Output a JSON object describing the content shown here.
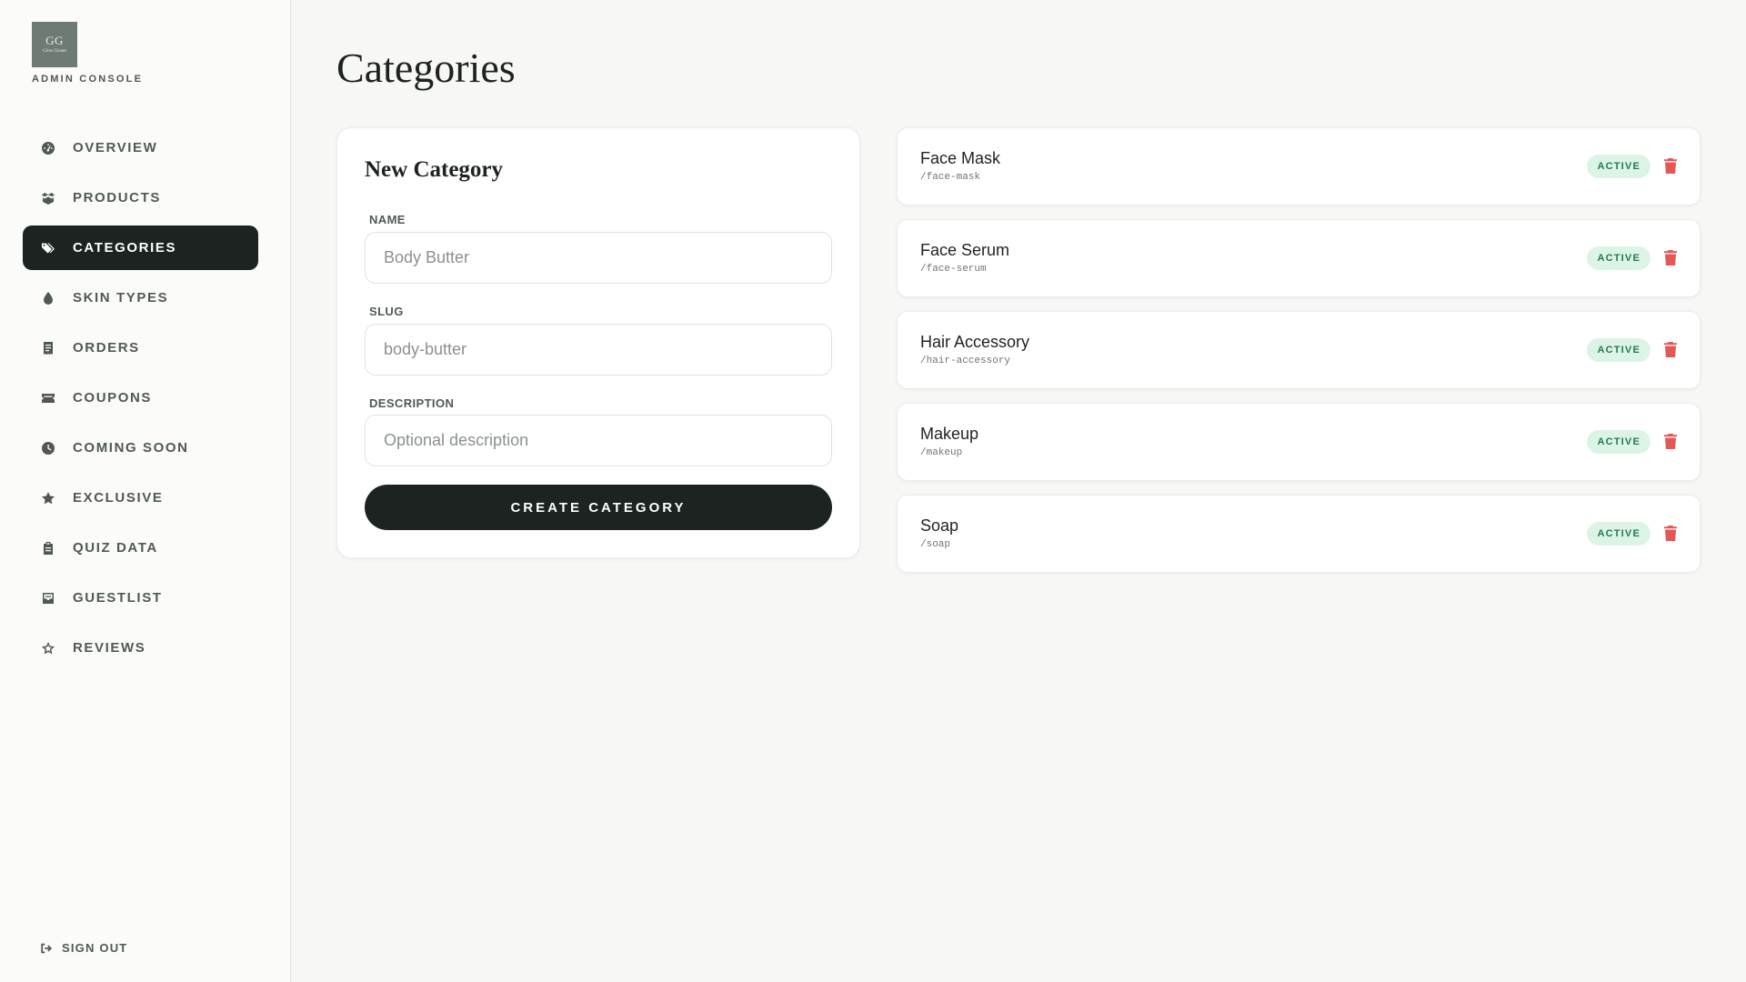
{
  "brand": {
    "logo_mark": "GG",
    "logo_small": "Glow Gleam",
    "subtitle": "ADMIN CONSOLE"
  },
  "sidebar": {
    "items": [
      {
        "label": "OVERVIEW",
        "icon": "dashboard-icon"
      },
      {
        "label": "PRODUCTS",
        "icon": "box-icon"
      },
      {
        "label": "CATEGORIES",
        "icon": "tags-icon",
        "active": true
      },
      {
        "label": "SKIN TYPES",
        "icon": "droplet-icon"
      },
      {
        "label": "ORDERS",
        "icon": "receipt-icon"
      },
      {
        "label": "COUPONS",
        "icon": "ticket-icon"
      },
      {
        "label": "COMING SOON",
        "icon": "clock-icon"
      },
      {
        "label": "EXCLUSIVE",
        "icon": "star-icon"
      },
      {
        "label": "QUIZ DATA",
        "icon": "clipboard-icon"
      },
      {
        "label": "GUESTLIST",
        "icon": "inbox-icon"
      },
      {
        "label": "REVIEWS",
        "icon": "star-outline-icon"
      }
    ],
    "signout_label": "SIGN OUT"
  },
  "page": {
    "title": "Categories"
  },
  "form": {
    "title": "New Category",
    "name_label": "NAME",
    "name_placeholder": "Body Butter",
    "slug_label": "SLUG",
    "slug_placeholder": "body-butter",
    "description_label": "DESCRIPTION",
    "description_placeholder": "Optional description",
    "submit_label": "CREATE CATEGORY"
  },
  "categories": [
    {
      "name": "Face Mask",
      "slug": "/face-mask",
      "status": "ACTIVE"
    },
    {
      "name": "Face Serum",
      "slug": "/face-serum",
      "status": "ACTIVE"
    },
    {
      "name": "Hair Accessory",
      "slug": "/hair-accessory",
      "status": "ACTIVE"
    },
    {
      "name": "Makeup",
      "slug": "/makeup",
      "status": "ACTIVE"
    },
    {
      "name": "Soap",
      "slug": "/soap",
      "status": "ACTIVE"
    }
  ],
  "colors": {
    "accent_dark": "#1c2321",
    "active_badge_bg": "#dcf4e6",
    "active_badge_text": "#237a4d",
    "delete_red": "#e45757"
  }
}
